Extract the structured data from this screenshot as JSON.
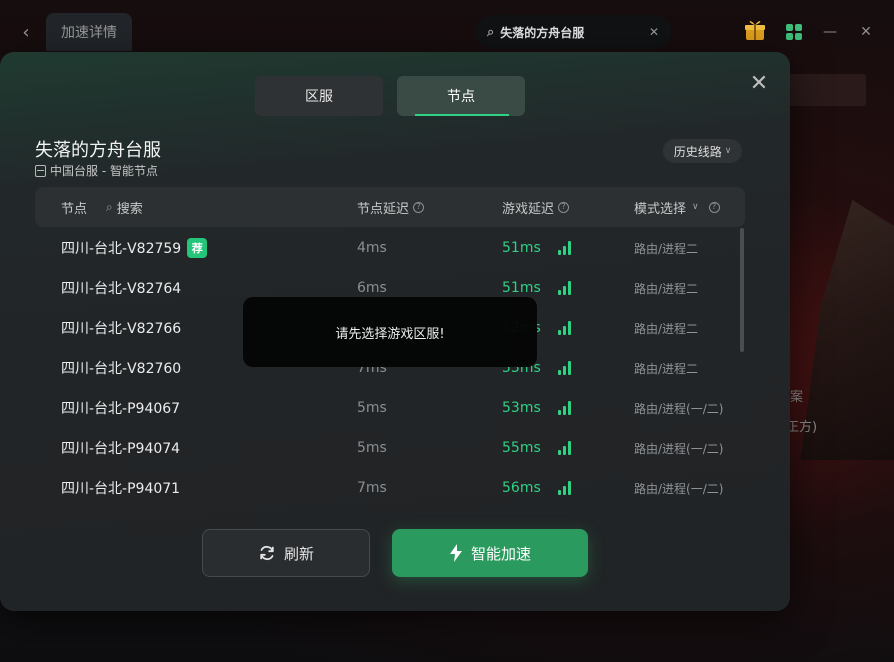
{
  "topbar": {
    "tab_label": "加速详情",
    "search_value": "失落的方舟台服",
    "accent_color": "#3fbf79"
  },
  "background": {
    "text_1": "案",
    "text_2": "正方)"
  },
  "modal": {
    "tabs": [
      {
        "label": "区服",
        "active": false
      },
      {
        "label": "节点",
        "active": true
      }
    ],
    "game_title": "失落的方舟台服",
    "game_subtitle": "中国台服 - 智能节点",
    "history_label": "历史线路",
    "columns": {
      "node": "节点",
      "search": "搜索",
      "node_latency": "节点延迟",
      "game_latency": "游戏延迟",
      "mode": "模式选择"
    },
    "recommended_badge": "荐",
    "rows": [
      {
        "name": "四川-台北-V82759",
        "node_latency": "4ms",
        "game_latency": "51ms",
        "mode": "路由/进程二",
        "recommended": true
      },
      {
        "name": "四川-台北-V82764",
        "node_latency": "6ms",
        "game_latency": "51ms",
        "mode": "路由/进程二"
      },
      {
        "name": "四川-台北-V82766",
        "node_latency": "",
        "game_latency": "52ms",
        "mode": "路由/进程二"
      },
      {
        "name": "四川-台北-V82760",
        "node_latency": "7ms",
        "game_latency": "53ms",
        "mode": "路由/进程二"
      },
      {
        "name": "四川-台北-P94067",
        "node_latency": "5ms",
        "game_latency": "53ms",
        "mode": "路由/进程(一/二)"
      },
      {
        "name": "四川-台北-P94074",
        "node_latency": "5ms",
        "game_latency": "55ms",
        "mode": "路由/进程(一/二)"
      },
      {
        "name": "四川-台北-P94071",
        "node_latency": "7ms",
        "game_latency": "56ms",
        "mode": "路由/进程(一/二)"
      }
    ],
    "toast": "请先选择游戏区服!",
    "refresh_label": "刷新",
    "accelerate_label": "智能加速",
    "accelerate_color": "#2b9a5f",
    "latency_color": "#2fd183"
  }
}
